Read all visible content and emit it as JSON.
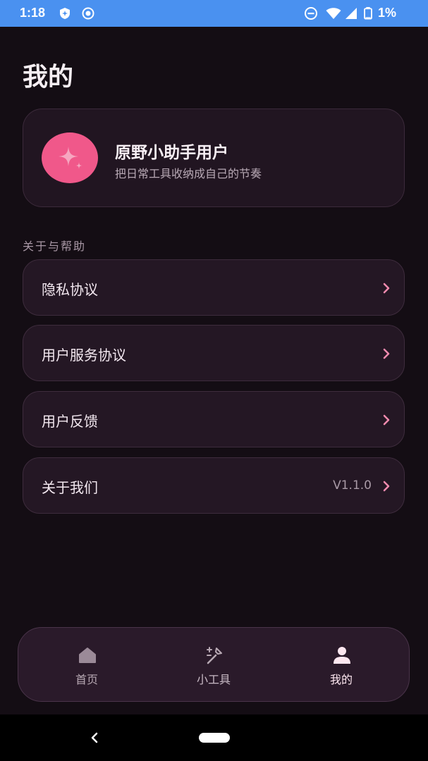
{
  "status_bar": {
    "time": "1:18",
    "battery": "1%",
    "icons": [
      "shield-icon",
      "record-icon",
      "do-not-disturb-icon",
      "wifi-icon",
      "signal-icon",
      "battery-icon"
    ]
  },
  "page": {
    "title": "我的"
  },
  "profile": {
    "name": "原野小助手用户",
    "subtitle": "把日常工具收纳成自己的节奏",
    "avatar_icon": "sparkle-icon",
    "avatar_color": "#f0588a"
  },
  "section": {
    "title": "关于与帮助"
  },
  "menu": [
    {
      "label": "隐私协议",
      "value": ""
    },
    {
      "label": "用户服务协议",
      "value": ""
    },
    {
      "label": "用户反馈",
      "value": ""
    },
    {
      "label": "关于我们",
      "value": "V1.1.0"
    }
  ],
  "tabs": [
    {
      "label": "首页",
      "icon": "home-icon",
      "active": false
    },
    {
      "label": "小工具",
      "icon": "magic-wand-icon",
      "active": false
    },
    {
      "label": "我的",
      "icon": "person-icon",
      "active": true
    }
  ],
  "colors": {
    "background": "#140d14",
    "accent": "#f0588a",
    "chevron": "#f08aae",
    "status_bar": "#4a91f0"
  }
}
